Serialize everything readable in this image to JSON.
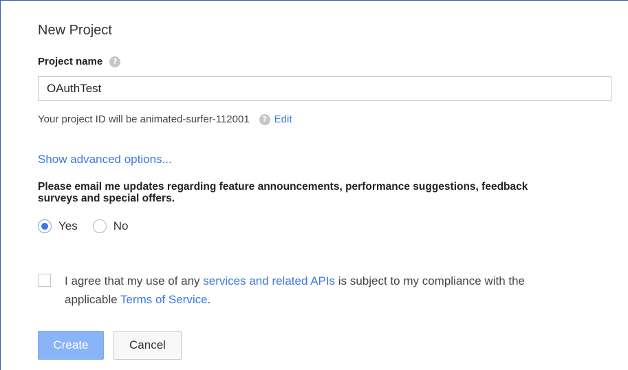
{
  "dialog": {
    "title": "New Project",
    "project_name_label": "Project name",
    "help_icon_glyph": "?",
    "project_name_value": "OAuthTest",
    "project_id_text": "Your project ID will be animated-surfer-112001",
    "edit_link": "Edit",
    "advanced_link": "Show advanced options...",
    "email_updates_text": "Please email me updates regarding feature announcements, performance suggestions, feedback surveys and special offers.",
    "radio_options": [
      {
        "label": "Yes",
        "checked": true
      },
      {
        "label": "No",
        "checked": false
      }
    ],
    "agree": {
      "checked": false,
      "text_before": "I agree that my use of any ",
      "link1": "services and related APIs",
      "text_middle": " is subject to my compliance with the applicable ",
      "link2": "Terms of Service",
      "text_after": "."
    },
    "create_label": "Create",
    "cancel_label": "Cancel"
  },
  "colors": {
    "link": "#3b78e7",
    "create_button": "#8ab4f8",
    "frame_border": "#2b5fa8"
  },
  "icons": {
    "help": "help-circle-icon"
  }
}
